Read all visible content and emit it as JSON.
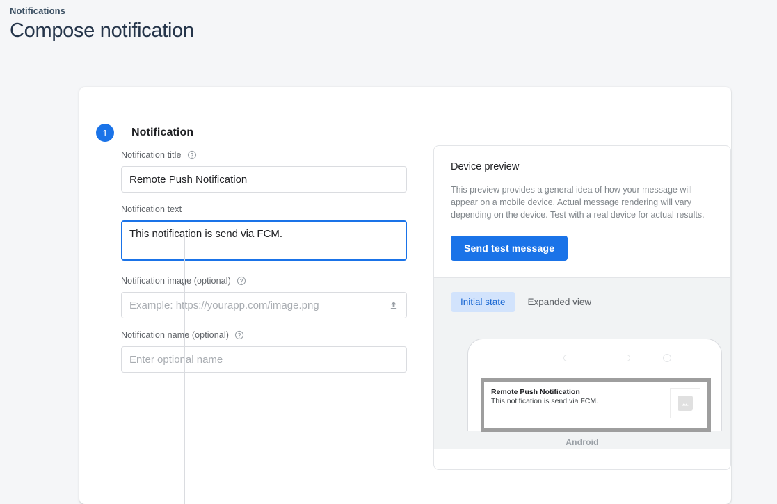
{
  "header": {
    "breadcrumb": "Notifications",
    "title": "Compose notification"
  },
  "step": {
    "number": "1",
    "title": "Notification"
  },
  "form": {
    "title_field": {
      "label": "Notification title",
      "value": "Remote Push Notification",
      "placeholder": "",
      "help_icon": "help-circle-icon"
    },
    "text_field": {
      "label": "Notification text",
      "value": "This notification is send via FCM.",
      "placeholder": "",
      "focused": true
    },
    "image_field": {
      "label": "Notification image (optional)",
      "value": "",
      "placeholder": "Example: https://yourapp.com/image.png",
      "help_icon": "help-circle-icon",
      "upload_icon": "upload-icon"
    },
    "name_field": {
      "label": "Notification name (optional)",
      "value": "",
      "placeholder": "Enter optional name",
      "help_icon": "help-circle-icon"
    }
  },
  "preview": {
    "title": "Device preview",
    "description": "This preview provides a general idea of how your message will appear on a mobile device. Actual message rendering will vary depending on the device. Test with a real device for actual results.",
    "send_test_label": "Send test message",
    "tabs": [
      {
        "label": "Initial state",
        "active": true
      },
      {
        "label": "Expanded view",
        "active": false
      }
    ],
    "notification": {
      "title": "Remote Push Notification",
      "body": "This notification is send via FCM.",
      "thumb_icon": "image-placeholder-icon"
    },
    "device_label": "Android"
  },
  "colors": {
    "accent": "#1a73e8",
    "tab_active_bg": "#d2e3fc",
    "tab_active_text": "#1967d2",
    "page_bg": "#f5f6f8",
    "panel_bg": "#f1f3f4"
  }
}
